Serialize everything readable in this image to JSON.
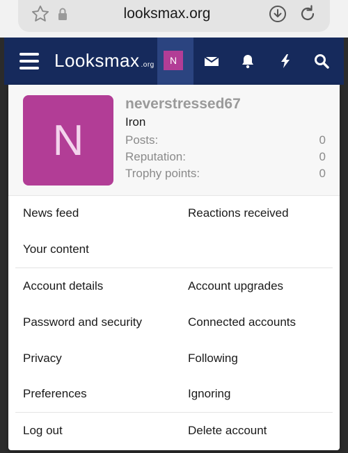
{
  "browser": {
    "url": "looksmax.org"
  },
  "navbar": {
    "logo_main": "Looksmax",
    "logo_suffix": ".org",
    "avatar_letter": "N"
  },
  "profile": {
    "avatar_letter": "N",
    "username": "neverstressed67",
    "title": "Iron",
    "stats": [
      {
        "label": "Posts:",
        "value": "0"
      },
      {
        "label": "Reputation:",
        "value": "0"
      },
      {
        "label": "Trophy points:",
        "value": "0"
      }
    ]
  },
  "menu": {
    "news_feed": "News feed",
    "reactions_received": "Reactions received",
    "your_content": "Your content",
    "account_details": "Account details",
    "account_upgrades": "Account upgrades",
    "password_security": "Password and security",
    "connected_accounts": "Connected accounts",
    "privacy": "Privacy",
    "following": "Following",
    "preferences": "Preferences",
    "ignoring": "Ignoring",
    "log_out": "Log out",
    "delete_account": "Delete account"
  },
  "colors": {
    "navbar": "#162a5c",
    "avatar": "#b23d96"
  }
}
